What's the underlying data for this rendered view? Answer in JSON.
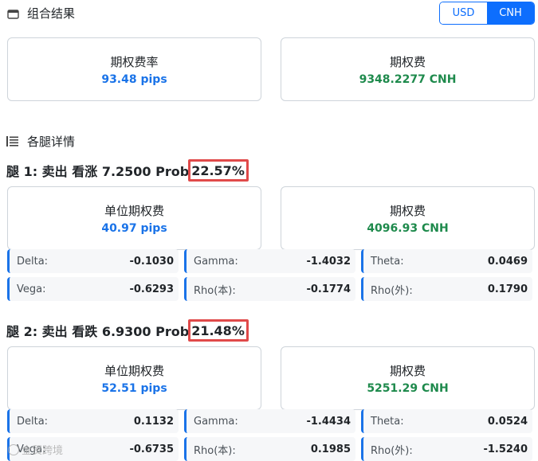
{
  "summary": {
    "title": "组合结果",
    "currency_toggle": {
      "usd": "USD",
      "cnh": "CNH",
      "selected": "CNH"
    },
    "rate_card": {
      "label": "期权费率",
      "value": "93.48 pips"
    },
    "premium_card": {
      "label": "期权费",
      "value": "9348.2277 CNH"
    }
  },
  "legs_section": {
    "title": "各腿详情"
  },
  "legs": [
    {
      "title_prefix": "腿 1: 卖出 看涨 7.2500 Prob",
      "prob": "22.57%",
      "unit_card": {
        "label": "单位期权费",
        "value": "40.97 pips"
      },
      "premium_card": {
        "label": "期权费",
        "value": "4096.93 CNH"
      },
      "greeks": [
        {
          "name": "Delta:",
          "value": "-0.1030"
        },
        {
          "name": "Gamma:",
          "value": "-1.4032"
        },
        {
          "name": "Theta:",
          "value": "0.0469"
        },
        {
          "name": "Vega:",
          "value": "-0.6293"
        },
        {
          "name": "Rho(本):",
          "value": "-0.1774"
        },
        {
          "name": "Rho(外):",
          "value": "0.1790"
        }
      ]
    },
    {
      "title_prefix": "腿 2: 卖出 看跌 6.9300 Prob",
      "prob": "21.48%",
      "unit_card": {
        "label": "单位期权费",
        "value": "52.51 pips"
      },
      "premium_card": {
        "label": "期权费",
        "value": "5251.29 CNH"
      },
      "greeks": [
        {
          "name": "Delta:",
          "value": "0.1132"
        },
        {
          "name": "Gamma:",
          "value": "-1.4434"
        },
        {
          "name": "Theta:",
          "value": "0.0524"
        },
        {
          "name": "Vega:",
          "value": "-0.6735"
        },
        {
          "name": "Rho(本):",
          "value": "0.1985"
        },
        {
          "name": "Rho(外):",
          "value": "-1.5240"
        }
      ]
    }
  ],
  "watermark": {
    "text": "金贸跨境"
  },
  "colors": {
    "accent": "#0d6efd",
    "pips_blue": "#1a73e8",
    "premium_green": "#1e8a4c",
    "highlight_red": "#e04a4a"
  }
}
